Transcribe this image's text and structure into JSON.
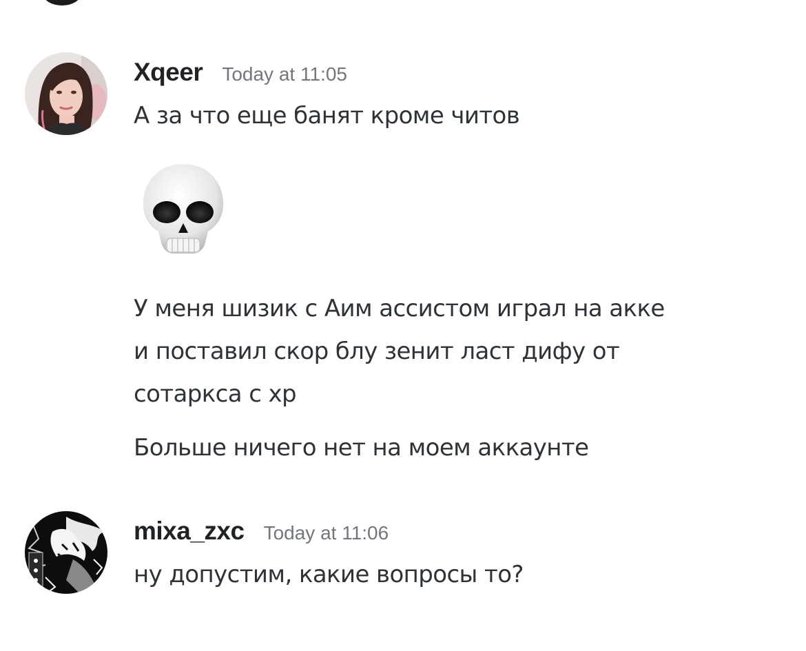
{
  "messages": [
    {
      "username": "Xqeer",
      "timestamp": "Today at 11:05",
      "avatar": "girl-portrait-avatar",
      "lines": [
        "А за что еще банят кроме читов"
      ],
      "emoji": "skull-emoji",
      "paragraph_lines": [
        "У меня шизик с Аим ассистом играл на акке",
        "и поставил скор блу зенит ласт дифу от",
        "сотаркса с хр"
      ],
      "last_line": "Больше ничего нет на моем аккаунте"
    },
    {
      "username": "mixa_zxc",
      "timestamp": "Today at 11:06",
      "avatar": "dark-anime-avatar",
      "lines": [
        "ну допустим, какие вопросы то?"
      ]
    }
  ],
  "colors": {
    "background": "#ffffff",
    "username": "#1f2326",
    "timestamp": "#72767d",
    "message_text": "#2e3338"
  }
}
